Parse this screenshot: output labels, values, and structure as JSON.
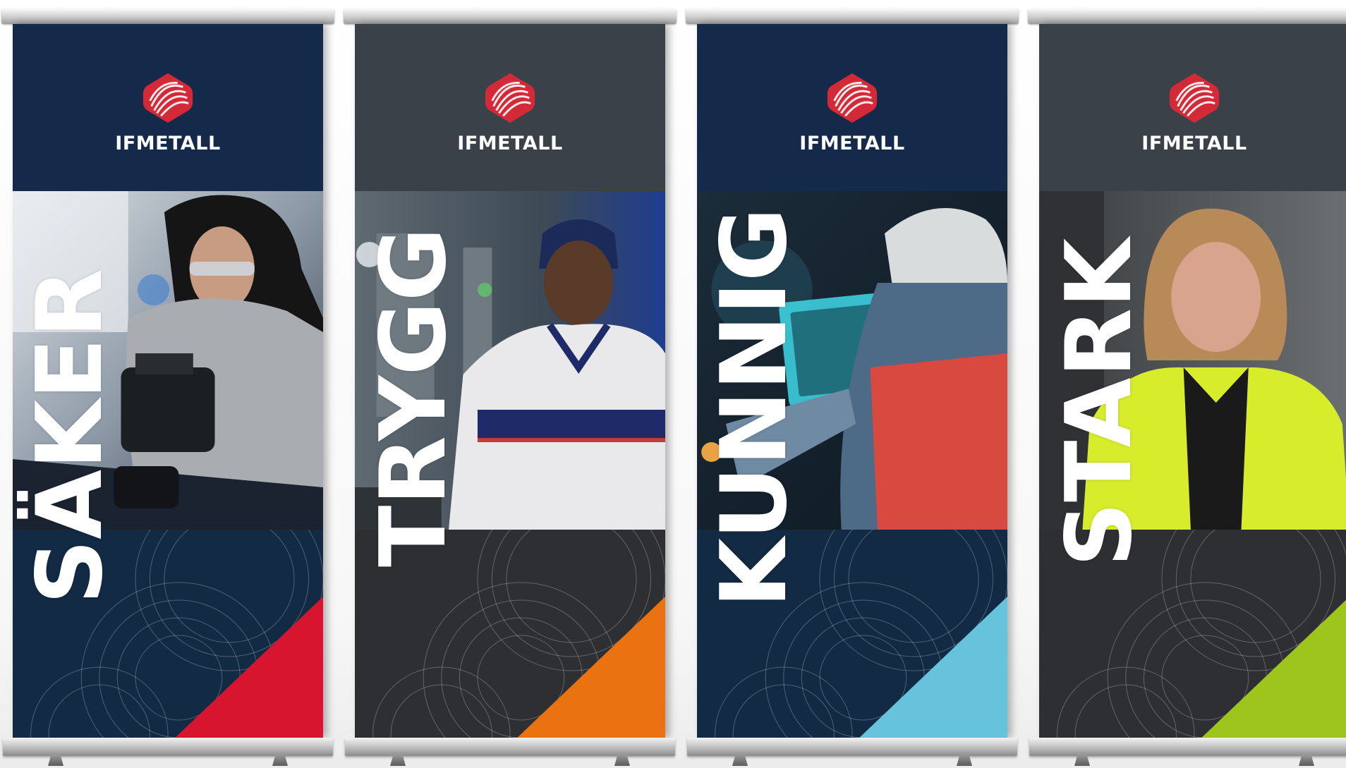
{
  "brand": {
    "logo_text": "IFMETALL",
    "logo_red": "#d42a37"
  },
  "banners": [
    {
      "word": "SÄKER",
      "header_color": "#15294a",
      "bottom_color": "#132a44",
      "accent": "#d7152e",
      "photo": "worker-with-safety-glasses"
    },
    {
      "word": "TRYGG",
      "header_color": "#3a4149",
      "bottom_color": "#2d2f33",
      "accent": "#ea7210",
      "photo": "worker-in-cap"
    },
    {
      "word": "KUNNIG",
      "header_color": "#15294a",
      "bottom_color": "#132a44",
      "accent": "#66c3db",
      "photo": "worker-with-tablet"
    },
    {
      "word": "STARK",
      "header_color": "#3a4149",
      "bottom_color": "#2d2f33",
      "accent": "#9ec51c",
      "photo": "worker-in-hi-vis-jacket"
    }
  ]
}
